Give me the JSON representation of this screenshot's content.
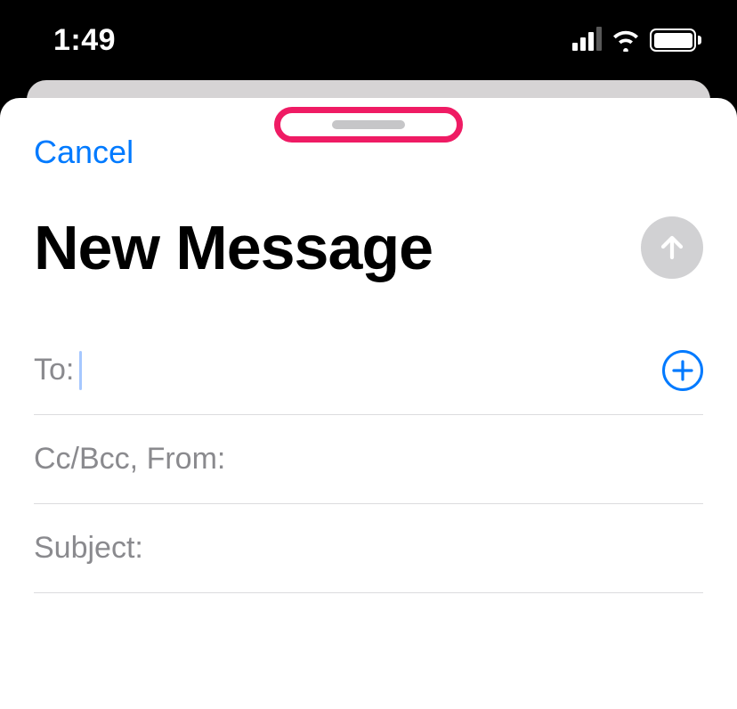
{
  "status_bar": {
    "time": "1:49"
  },
  "sheet": {
    "cancel_label": "Cancel",
    "title": "New Message",
    "fields": {
      "to_label": "To:",
      "to_value": "",
      "ccbcc_label": "Cc/Bcc, From:",
      "ccbcc_value": "",
      "subject_label": "Subject:",
      "subject_value": ""
    }
  }
}
